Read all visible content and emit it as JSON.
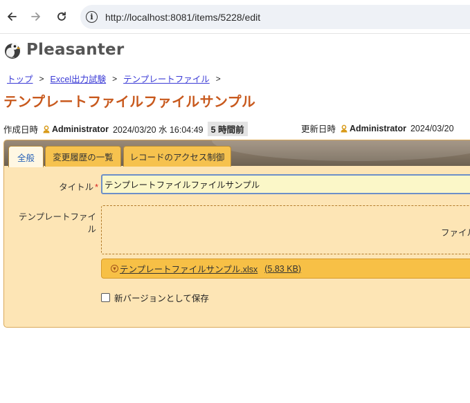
{
  "browser": {
    "url": "http://localhost:8081/items/5228/edit"
  },
  "logo": {
    "text": "Pleasanter"
  },
  "breadcrumb": [
    {
      "label": "トップ"
    },
    {
      "label": "Excel出力試験"
    },
    {
      "label": "テンプレートファイル"
    }
  ],
  "breadcrumb_sep": ">",
  "page_title": "テンプレートファイルファイルサンプル",
  "meta": {
    "created_label": "作成日時",
    "created_user": "Administrator",
    "created_date": "2024/03/20 水 16:04:49",
    "created_ago": "5 時間前",
    "updated_label": "更新日時",
    "updated_user": "Administrator",
    "updated_date": "2024/03/20"
  },
  "tabs": [
    {
      "label": "全般"
    },
    {
      "label": "変更履歴の一覧"
    },
    {
      "label": "レコードのアクセス制御"
    }
  ],
  "form": {
    "title_label": "タイトル",
    "required_mark": "*",
    "title_value": "テンプレートファイルファイルサンプル",
    "template_label_line1": "テンプレートファイ",
    "template_label_line2": "ル",
    "drop_text": "ファイル",
    "file_name": "テンプレートファイルサンプル.xlsx",
    "file_size": "(5.83 KB)",
    "new_version_label": "新バージョンとして保存"
  }
}
